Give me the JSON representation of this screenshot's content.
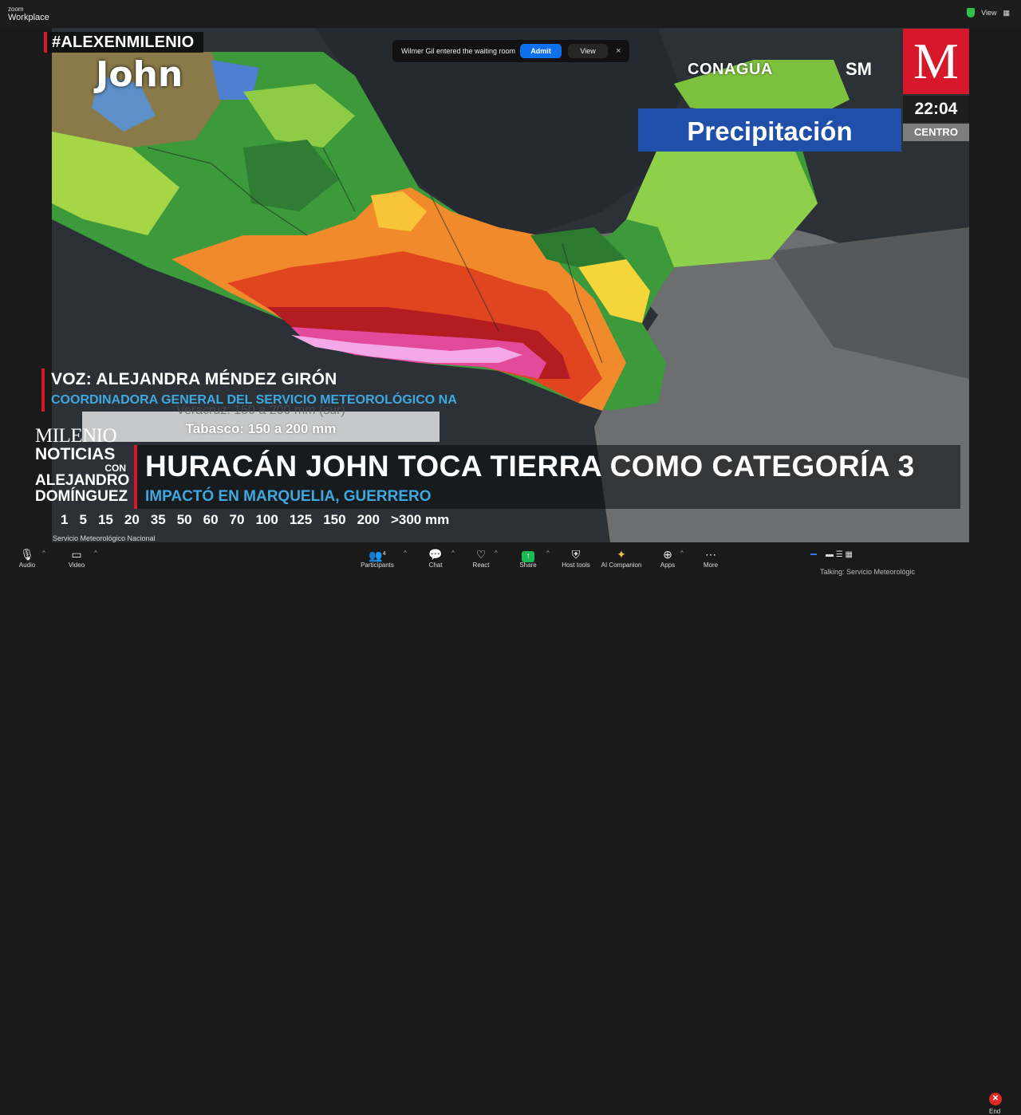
{
  "app": {
    "brand_small": "zoom",
    "brand_main": "Workplace",
    "view_label": "View"
  },
  "notification": {
    "message": "Wilmer Gil entered the waiting room",
    "admit": "Admit",
    "view": "View",
    "close": "×"
  },
  "broadcast": {
    "hashtag": "#ALEXENMILENIO",
    "map_label": "John",
    "partner_logo": "CONAGUA",
    "partner_logo2": "SM",
    "channel_logo": "M",
    "time": "22:04",
    "zone": "CENTRO",
    "section": "Precipitación",
    "speaker": "VOZ: ALEJANDRA MÉNDEZ GIRÓN",
    "speaker_role": "COORDINADORA GENERAL DEL SERVICIO METEOROLÓGICO NA",
    "legend_line1": "Veracruz: 150 a 200 mm (sur)",
    "legend_line2": "Tabasco: 150 a 200 mm",
    "show_milenio": "MILENIO",
    "show_noticias": "NOTICIAS",
    "show_con": "CON",
    "show_host1": "ALEJANDRO",
    "show_host2": "DOMÍNGUEZ",
    "headline": "HURACÁN JOHN TOCA TIERRA COMO CATEGORÍA 3",
    "subheadline": "IMPACTÓ EN MARQUELIA, GUERRERO",
    "scale": [
      "1",
      "5",
      "15",
      "20",
      "35",
      "50",
      "60",
      "70",
      "100",
      "125",
      "150",
      "200",
      ">300 mm"
    ],
    "source": "Servicio Meteorológico Nacional"
  },
  "toolbar": {
    "audio": "Audio",
    "video": "Video",
    "participants": "Participants",
    "participants_count": "4",
    "chat": "Chat",
    "react": "React",
    "share": "Share",
    "host_tools": "Host tools",
    "ai_companion": "AI Companion",
    "apps": "Apps",
    "more": "More",
    "end": "End",
    "talking": "Talking: Servicio Meteorológic"
  },
  "colors": {
    "accent_red": "#d6182a",
    "zoom_blue": "#0e71eb",
    "section_blue": "#1f4fa8",
    "text_blue": "#3ea8e0",
    "share_green": "#1db954"
  }
}
